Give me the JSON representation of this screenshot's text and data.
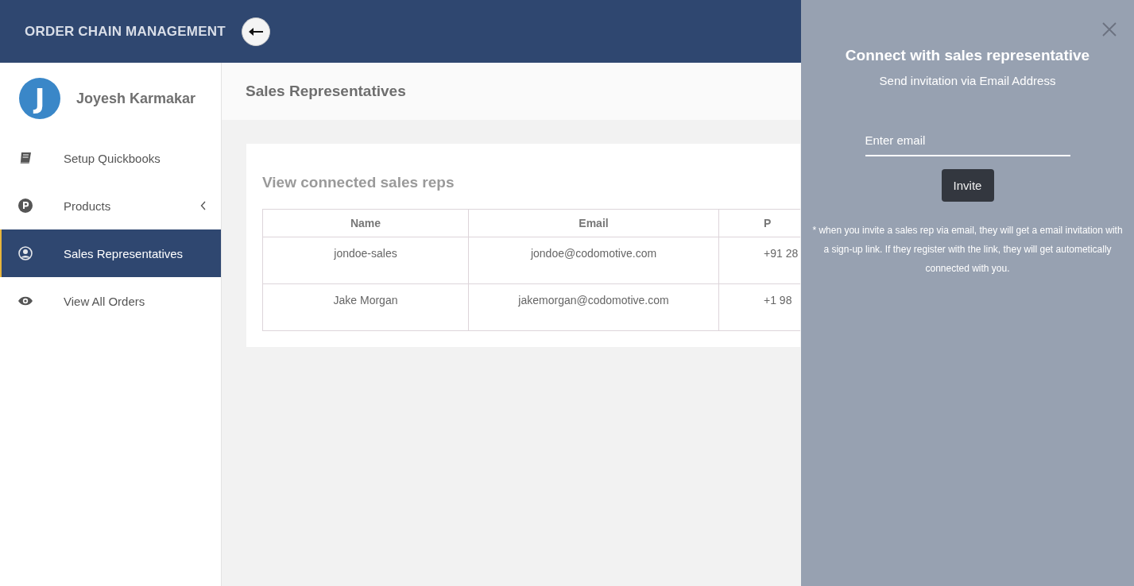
{
  "header": {
    "brand": "ORDER CHAIN **MANAGEMENT**"
  },
  "sidebar": {
    "user": {
      "initial": "J",
      "name": "Joyesh Karmakar"
    },
    "items": [
      {
        "label": "Setup Quickbooks",
        "selected": false,
        "has_submenu": false
      },
      {
        "label": "Products",
        "selected": false,
        "has_submenu": true
      },
      {
        "label": "Sales Representatives",
        "selected": true,
        "has_submenu": false
      },
      {
        "label": "View All Orders",
        "selected": false,
        "has_submenu": false
      }
    ]
  },
  "page": {
    "title": "Sales Representatives"
  },
  "card": {
    "title": "View connected sales reps",
    "table": {
      "columns": [
        "Name",
        "Email",
        "P"
      ],
      "rows": [
        [
          "jondoe-sales",
          "jondoe@codomotive.com",
          "+91 28"
        ],
        [
          "Jake Morgan",
          "jakemorgan@codomotive.com",
          "+1 98"
        ]
      ]
    }
  },
  "panel": {
    "title": "Connect with sales representative",
    "subtitle": "Send invitation via Email Address",
    "email_placeholder": "Enter email",
    "button": "Invite",
    "note": "* when you invite a sales rep via email, they will get a email invitation with a sign-up link. If they register with the link, they will get autometically connected with you."
  }
}
